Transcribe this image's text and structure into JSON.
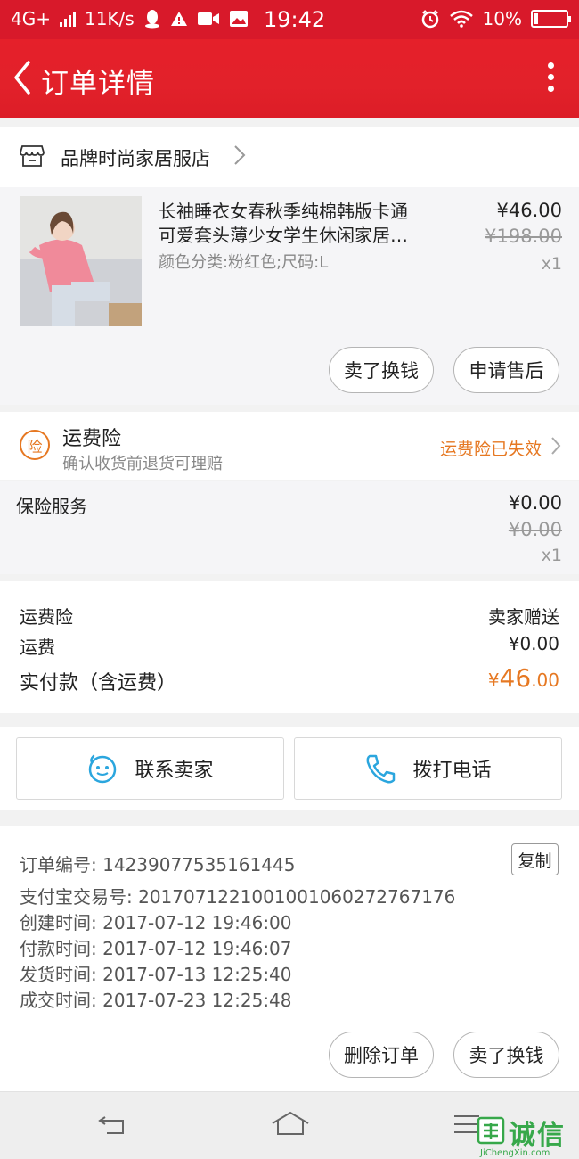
{
  "status_bar": {
    "network": "4G+",
    "speed": "11K/s",
    "time": "19:42",
    "battery": "10%"
  },
  "header": {
    "title": "订单详情"
  },
  "shop": {
    "name": "品牌时尚家居服店"
  },
  "product": {
    "title_line1": "长袖睡衣女春秋季纯棉韩版卡通",
    "title_line2": "可爱套头薄少女学生休闲家居…",
    "spec": "颜色分类:粉红色;尺码:L",
    "price": "¥46.00",
    "original_price": "¥198.00",
    "quantity": "x1",
    "buttons": {
      "exchange": "卖了换钱",
      "after_sale": "申请售后"
    }
  },
  "freight_insurance": {
    "title": "运费险",
    "subtitle": "确认收货前退货可理赔",
    "status": "运费险已失效",
    "badge": "险"
  },
  "insurance_service": {
    "label": "保险服务",
    "price": "¥0.00",
    "original_price": "¥0.00",
    "quantity": "x1"
  },
  "totals": {
    "freight_insurance_label": "运费险",
    "freight_insurance_value": "卖家赠送",
    "shipping_label": "运费",
    "shipping_value": "¥0.00",
    "paid_label": "实付款（含运费）",
    "paid_symbol": "¥",
    "paid_integer": "46",
    "paid_decimal": ".00"
  },
  "contact": {
    "seller": "联系卖家",
    "call": "拨打电话"
  },
  "order_info": {
    "order_no": "订单编号: 1423907753516144​5",
    "copy": "复制",
    "alipay_no": "支付宝交易号: 2017071221001001060272767176",
    "created": "创建时间: 2017-07-12 19:46:00",
    "paid": "付款时间: 2017-07-12 19:46:07",
    "shipped": "发货时间: 2017-07-13 12:25:40",
    "completed": "成交时间: 2017-07-23 12:25:48"
  },
  "footer_buttons": {
    "delete": "删除订单",
    "exchange": "卖了换钱"
  },
  "watermark": {
    "text": "诚信",
    "url": "JiChengXin.com"
  },
  "colors": {
    "brand_red": "#e2212a",
    "accent_orange": "#e67822",
    "icon_blue": "#2ba6de"
  },
  "icons": {
    "back": "back-arrow-icon",
    "more": "more-vertical-icon",
    "shop": "shop-icon",
    "chevron": "chevron-right-icon",
    "chat": "chat-face-icon",
    "phone": "phone-icon",
    "nav_back": "nav-back-icon",
    "nav_home": "nav-home-icon",
    "nav_menu": "nav-menu-icon"
  }
}
